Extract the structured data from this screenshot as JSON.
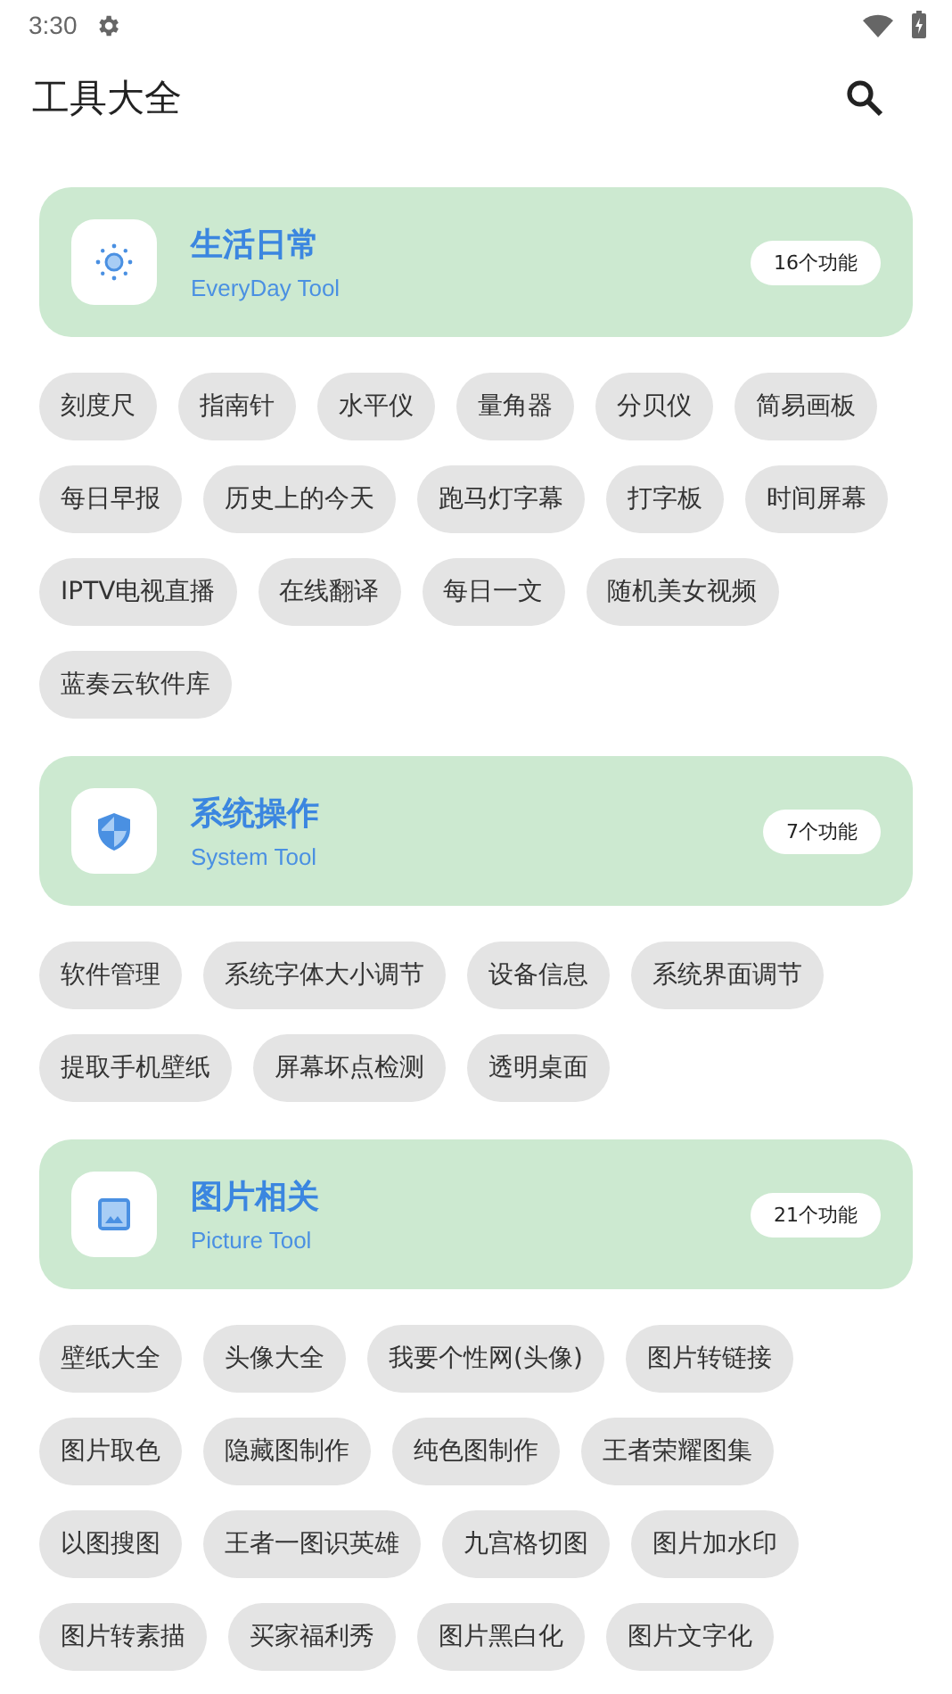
{
  "status_bar": {
    "time": "3:30"
  },
  "app_bar": {
    "title": "工具大全"
  },
  "categories": [
    {
      "kind": "everyday",
      "title": "生活日常",
      "subtitle": "EveryDay Tool",
      "count": "16个功能",
      "tools": [
        "刻度尺",
        "指南针",
        "水平仪",
        "量角器",
        "分贝仪",
        "简易画板",
        "每日早报",
        "历史上的今天",
        "跑马灯字幕",
        "打字板",
        "时间屏幕",
        "IPTV电视直播",
        "在线翻译",
        "每日一文",
        "随机美女视频",
        "蓝奏云软件库"
      ]
    },
    {
      "kind": "system",
      "title": "系统操作",
      "subtitle": "System Tool",
      "count": "7个功能",
      "tools": [
        "软件管理",
        "系统字体大小调节",
        "设备信息",
        "系统界面调节",
        "提取手机壁纸",
        "屏幕坏点检测",
        "透明桌面"
      ]
    },
    {
      "kind": "picture",
      "title": "图片相关",
      "subtitle": "Picture Tool",
      "count": "21个功能",
      "tools": [
        "壁纸大全",
        "头像大全",
        "我要个性网(头像)",
        "图片转链接",
        "图片取色",
        "隐藏图制作",
        "纯色图制作",
        "王者荣耀图集",
        "以图搜图",
        "王者一图识英雄",
        "九宫格切图",
        "图片加水印",
        "图片转素描",
        "买家福利秀",
        "图片黑白化",
        "图片文字化"
      ]
    }
  ]
}
